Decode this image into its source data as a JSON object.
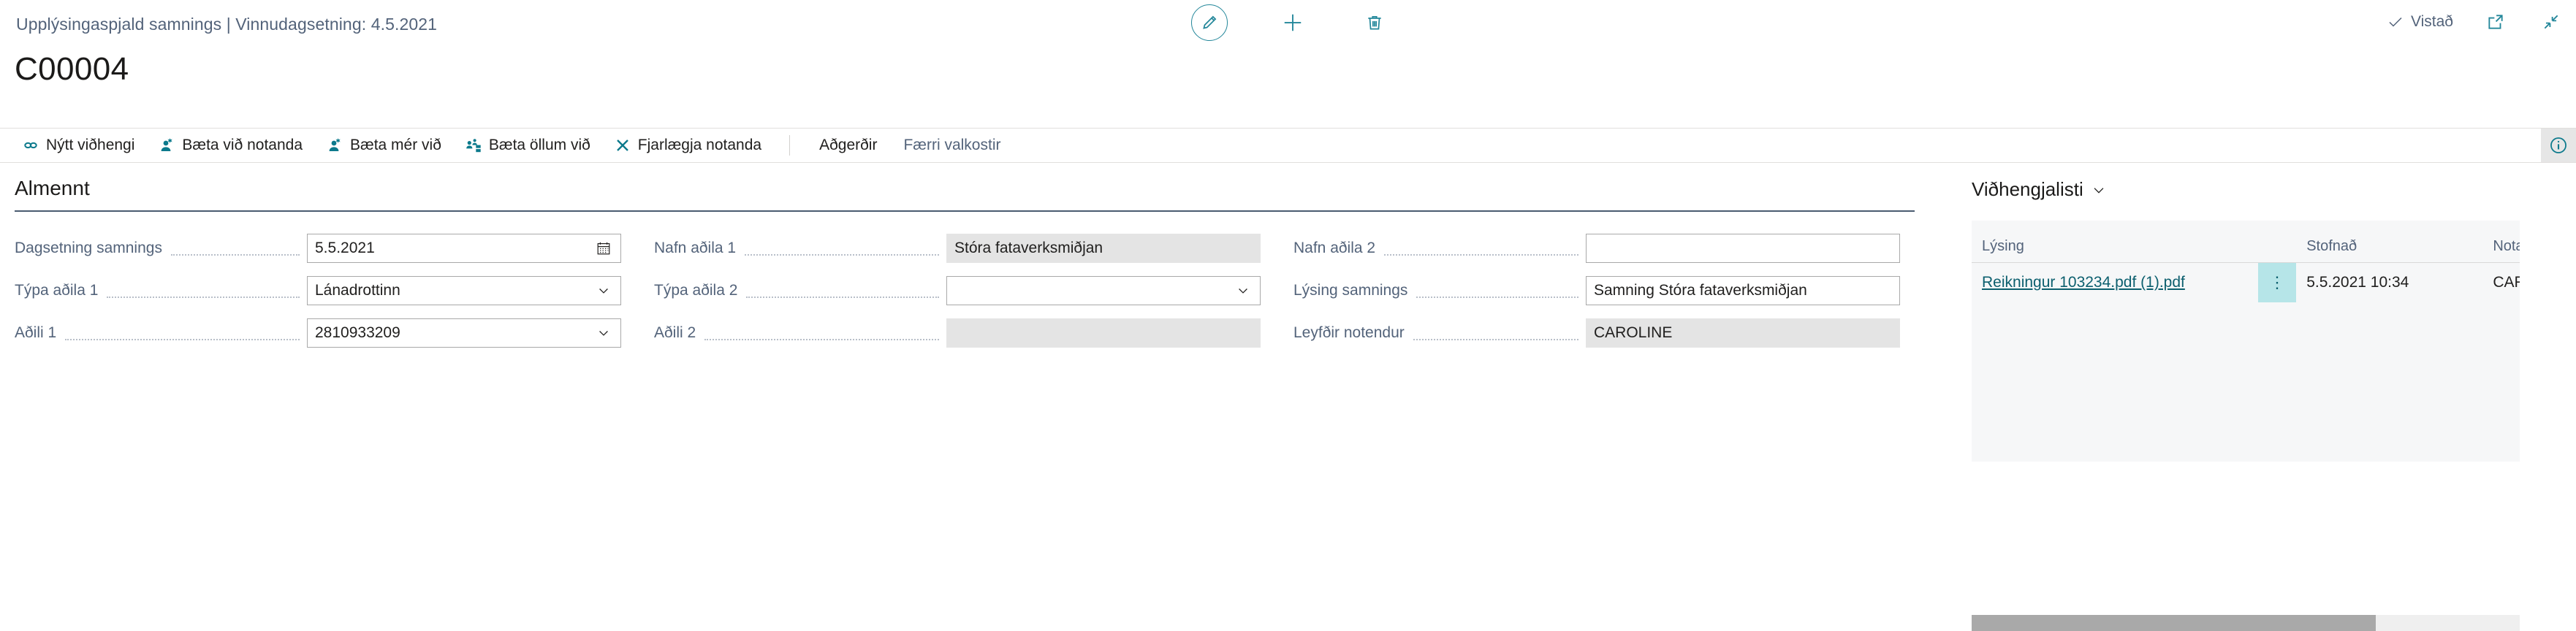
{
  "header": {
    "breadcrumb": "Upplýsingaspjald samnings | Vinnudagsetning: 4.5.2021",
    "record_title": "C00004",
    "center_actions": [
      {
        "name": "edit-icon",
        "label": "Breyta"
      },
      {
        "name": "add-icon",
        "label": "Nýtt"
      },
      {
        "name": "delete-icon",
        "label": "Eyða"
      }
    ],
    "saved_status": "Vistað",
    "window_actions": [
      {
        "name": "open-in-new-window-icon",
        "label": "Opna í nýjum glugga"
      },
      {
        "name": "collapse-icon",
        "label": "Minnka"
      }
    ]
  },
  "ribbon": {
    "items": [
      {
        "icon": "link-icon",
        "label": "Nýtt viðhengi"
      },
      {
        "icon": "add-user-icon",
        "label": "Bæta við notanda"
      },
      {
        "icon": "add-me-icon",
        "label": "Bæta mér við"
      },
      {
        "icon": "add-all-icon",
        "label": "Bæta öllum við"
      },
      {
        "icon": "remove-user-icon",
        "label": "Fjarlægja notanda"
      }
    ],
    "text_items": [
      {
        "label": "Aðgerðir",
        "muted": false
      },
      {
        "label": "Færri valkostir",
        "muted": true
      }
    ],
    "info_icon_label": "Upplýsingar"
  },
  "general": {
    "section_title": "Almennt",
    "columns": [
      {
        "fields": [
          {
            "label": "Dagsetning samnings",
            "value": "5.5.2021",
            "control": "date",
            "disabled": false
          },
          {
            "label": "Týpa aðila 1",
            "value": "Lánadrottinn",
            "control": "dropdown",
            "disabled": false
          },
          {
            "label": "Aðili 1",
            "value": "2810933209",
            "control": "dropdown",
            "disabled": false
          }
        ]
      },
      {
        "fields": [
          {
            "label": "Nafn aðila 1",
            "value": "Stóra fataverksmiðjan",
            "control": "text",
            "disabled": true
          },
          {
            "label": "Týpa aðila 2",
            "value": "",
            "control": "dropdown",
            "disabled": false
          },
          {
            "label": "Aðili 2",
            "value": "",
            "control": "text",
            "disabled": true
          }
        ]
      },
      {
        "fields": [
          {
            "label": "Nafn aðila 2",
            "value": "",
            "control": "text",
            "disabled": false
          },
          {
            "label": "Lýsing samnings",
            "value": "Samning Stóra fataverksmiðjan",
            "control": "text",
            "disabled": false
          },
          {
            "label": "Leyfðir notendur",
            "value": "CAROLINE",
            "control": "text",
            "disabled": true
          }
        ]
      }
    ]
  },
  "attachments": {
    "title": "Viðhengjalisti",
    "columns": [
      "Lýsing",
      "",
      "Stofnað",
      "Notandakó"
    ],
    "rows": [
      {
        "description": "Reikningur 103234.pdf (1).pdf",
        "menu": "⋮",
        "created": "5.5.2021 10:34",
        "user": "CAROLIN"
      }
    ]
  },
  "colors": {
    "accent_teal": "#23879a",
    "link_teal": "#0c5f6e",
    "cell_highlight": "#b6e5e8",
    "label_slate": "#53637a",
    "rule_slate": "#4a5b70",
    "disabled_field": "#e4e4e4"
  }
}
